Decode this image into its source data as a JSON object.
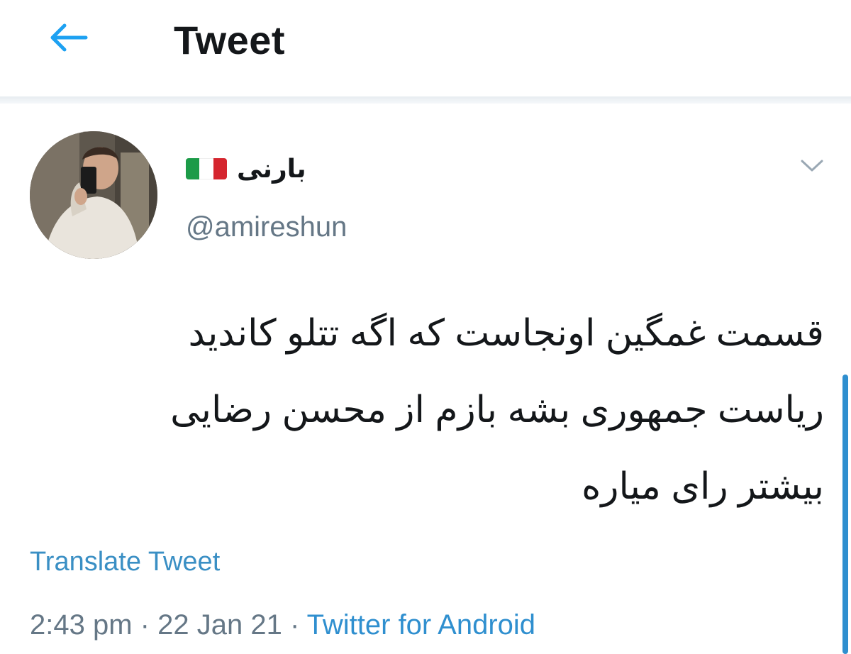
{
  "header": {
    "title": "Tweet",
    "back_icon": "arrow-left-icon",
    "accent": "#1da1f2"
  },
  "tweet": {
    "author": {
      "display_name": "بارنی",
      "flag_icon": "italy-flag-icon",
      "flag_colors": [
        "#1c9b48",
        "#ffffff",
        "#d5252e"
      ],
      "handle": "@amireshun"
    },
    "more_icon": "chevron-down-icon",
    "text_lines": [
      "قسمت غمگین اونجاست که اگه تتلو کاندید",
      "ریاست جمهوری بشه بازم از محسن رضایی",
      "بیشتر رای میاره"
    ],
    "translate_label": "Translate Tweet",
    "time": "2:43 pm",
    "separator": "·",
    "date": "22 Jan 21",
    "source": "Twitter for Android"
  },
  "colors": {
    "text_primary": "#14171a",
    "text_secondary": "#657786",
    "link": "#2f8fcf"
  }
}
